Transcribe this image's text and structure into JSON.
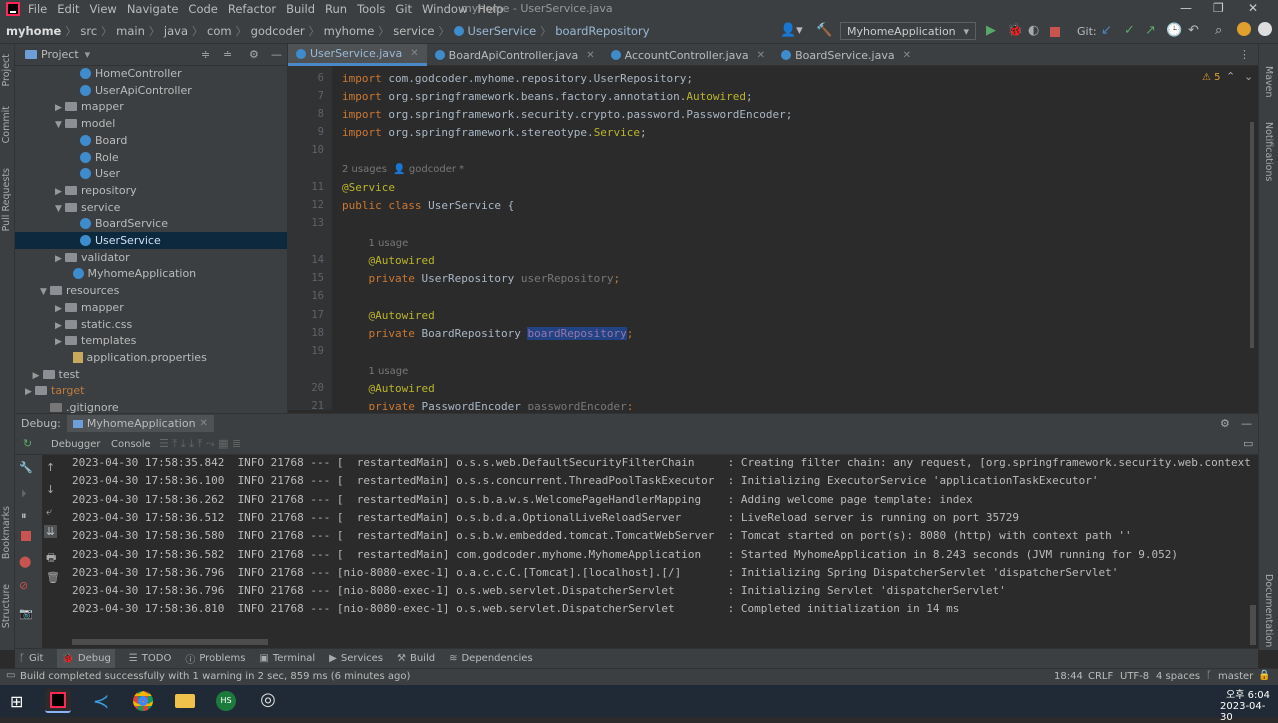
{
  "menu": {
    "items": [
      "File",
      "Edit",
      "View",
      "Navigate",
      "Code",
      "Refactor",
      "Build",
      "Run",
      "Tools",
      "Git",
      "Window",
      "Help"
    ],
    "window_title": "myhome - UserService.java"
  },
  "breadcrumb": [
    "myhome",
    "src",
    "main",
    "java",
    "com",
    "godcoder",
    "myhome",
    "service",
    "UserService",
    "boardRepository"
  ],
  "toolbar": {
    "run_config": "MyhomeApplication",
    "git_label": "Git:"
  },
  "project": {
    "title": "Project",
    "tree": [
      {
        "label": "HomeController",
        "type": "class",
        "indent": 3
      },
      {
        "label": "UserApiController",
        "type": "class",
        "indent": 3
      },
      {
        "label": "mapper",
        "type": "folder",
        "indent": 2,
        "arrow": "▶"
      },
      {
        "label": "model",
        "type": "folder",
        "indent": 2,
        "arrow": "▼"
      },
      {
        "label": "Board",
        "type": "class",
        "indent": 3
      },
      {
        "label": "Role",
        "type": "class",
        "indent": 3
      },
      {
        "label": "User",
        "type": "class",
        "indent": 3
      },
      {
        "label": "repository",
        "type": "folder",
        "indent": 2,
        "arrow": "▶"
      },
      {
        "label": "service",
        "type": "folder",
        "indent": 2,
        "arrow": "▼"
      },
      {
        "label": "BoardService",
        "type": "class",
        "indent": 3
      },
      {
        "label": "UserService",
        "type": "class",
        "indent": 3,
        "selected": true
      },
      {
        "label": "validator",
        "type": "folder",
        "indent": 2,
        "arrow": "▶"
      },
      {
        "label": "MyhomeApplication",
        "type": "class",
        "indent": 2.5
      },
      {
        "label": "resources",
        "type": "folder",
        "indent": 1,
        "arrow": "▼"
      },
      {
        "label": "mapper",
        "type": "folder",
        "indent": 2,
        "arrow": "▶"
      },
      {
        "label": "static.css",
        "type": "folder",
        "indent": 2,
        "arrow": "▶"
      },
      {
        "label": "templates",
        "type": "folder",
        "indent": 2,
        "arrow": "▶"
      },
      {
        "label": "application.properties",
        "type": "props",
        "indent": 2.5
      },
      {
        "label": "test",
        "type": "folder",
        "indent": 0.5,
        "arrow": "▶"
      },
      {
        "label": "target",
        "type": "folder",
        "indent": 0,
        "arrow": "▶",
        "color": "#c07a3e"
      },
      {
        "label": ".gitignore",
        "type": "file",
        "indent": 1
      }
    ]
  },
  "editor_tabs": [
    {
      "label": "UserService.java",
      "active": true
    },
    {
      "label": "BoardApiController.java",
      "active": false
    },
    {
      "label": "AccountController.java",
      "active": false
    },
    {
      "label": "BoardService.java",
      "active": false
    }
  ],
  "editor": {
    "warnings": "5",
    "lines": [
      {
        "n": "6",
        "html": "<span class='kw'>import</span> <span class='pl'>com.godcoder.myhome.repository.UserRepository;</span>"
      },
      {
        "n": "7",
        "html": "<span class='kw'>import</span> <span class='pl'>org.springframework.beans.factory.annotation.</span><span class='ann'>Autowired</span><span class='pl'>;</span>"
      },
      {
        "n": "8",
        "html": "<span class='kw'>import</span> <span class='pl'>org.springframework.security.crypto.password.PasswordEncoder;</span>"
      },
      {
        "n": "9",
        "html": "<span class='kw'>import</span> <span class='pl'>org.springframework.stereotype.</span><span class='ann'>Service</span><span class='pl'>;</span>"
      },
      {
        "n": "10",
        "html": ""
      },
      {
        "n": "",
        "html": "<span class='hint'>2 usages  &#x1F464; godcoder *</span>"
      },
      {
        "n": "11",
        "html": "<span class='ann'>@Service</span>"
      },
      {
        "n": "12",
        "html": "<span class='kw'>public class</span> <span class='pl'>UserService {</span>"
      },
      {
        "n": "13",
        "html": ""
      },
      {
        "n": "",
        "html": "    <span class='hint'>1 usage</span>"
      },
      {
        "n": "14",
        "html": "    <span class='ann'>@Autowired</span>"
      },
      {
        "n": "15",
        "html": "    <span class='kw'>private</span> <span class='pl'>UserRepository</span> <span class='gy'>userRepository</span><span class='kw'>;</span>"
      },
      {
        "n": "16",
        "html": ""
      },
      {
        "n": "17",
        "html": "    <span class='ann'>@Autowired</span>"
      },
      {
        "n": "18",
        "html": "    <span class='kw'>private</span> <span class='pl'>BoardRepository</span> <span class='selw'>boardRepository</span><span class='kw'>;</span>"
      },
      {
        "n": "19",
        "html": ""
      },
      {
        "n": "",
        "html": "    <span class='hint'>1 usage</span>"
      },
      {
        "n": "20",
        "html": "    <span class='ann'>@Autowired</span>"
      },
      {
        "n": "21",
        "html": "    <span class='kw'>private</span> <span class='pl'>PasswordEncoder</span> <span class='gy'>passwordEncoder</span><span class='kw'>;</span>"
      }
    ]
  },
  "debug": {
    "label": "Debug:",
    "config": "MyhomeApplication",
    "subtabs": [
      "Debugger",
      "Console"
    ],
    "logs": [
      "2023-04-30 17:58:35.842  INFO 21768 --- [  restartedMain] o.s.s.web.DefaultSecurityFilterChain     : Creating filter chain: any request, [org.springframework.security.web.context",
      "2023-04-30 17:58:36.100  INFO 21768 --- [  restartedMain] o.s.s.concurrent.ThreadPoolTaskExecutor  : Initializing ExecutorService 'applicationTaskExecutor'",
      "2023-04-30 17:58:36.262  INFO 21768 --- [  restartedMain] o.s.b.a.w.s.WelcomePageHandlerMapping    : Adding welcome page template: index",
      "2023-04-30 17:58:36.512  INFO 21768 --- [  restartedMain] o.s.b.d.a.OptionalLiveReloadServer       : LiveReload server is running on port 35729",
      "2023-04-30 17:58:36.580  INFO 21768 --- [  restartedMain] o.s.b.w.embedded.tomcat.TomcatWebServer  : Tomcat started on port(s): 8080 (http) with context path ''",
      "2023-04-30 17:58:36.582  INFO 21768 --- [  restartedMain] com.godcoder.myhome.MyhomeApplication    : Started MyhomeApplication in 8.243 seconds (JVM running for 9.052)",
      "2023-04-30 17:58:36.796  INFO 21768 --- [nio-8080-exec-1] o.a.c.c.C.[Tomcat].[localhost].[/]       : Initializing Spring DispatcherServlet 'dispatcherServlet'",
      "2023-04-30 17:58:36.796  INFO 21768 --- [nio-8080-exec-1] o.s.web.servlet.DispatcherServlet        : Initializing Servlet 'dispatcherServlet'",
      "2023-04-30 17:58:36.810  INFO 21768 --- [nio-8080-exec-1] o.s.web.servlet.DispatcherServlet        : Completed initialization in 14 ms"
    ]
  },
  "bottom_tabs": [
    "Git",
    "Debug",
    "TODO",
    "Problems",
    "Terminal",
    "Services",
    "Build",
    "Dependencies"
  ],
  "status": {
    "message": "Build completed successfully with 1 warning in 2 sec, 859 ms (6 minutes ago)",
    "position": "18:44",
    "line_sep": "CRLF",
    "encoding": "UTF-8",
    "indent": "4 spaces",
    "branch": "master"
  },
  "taskbar": {
    "time": "오후 6:04",
    "date": "2023-04-30"
  },
  "side_labels": {
    "left": [
      "Project",
      "Commit",
      "Pull Requests",
      "Bookmarks",
      "Structure"
    ],
    "right": [
      "Maven",
      "Notifications",
      "Documentation"
    ]
  }
}
